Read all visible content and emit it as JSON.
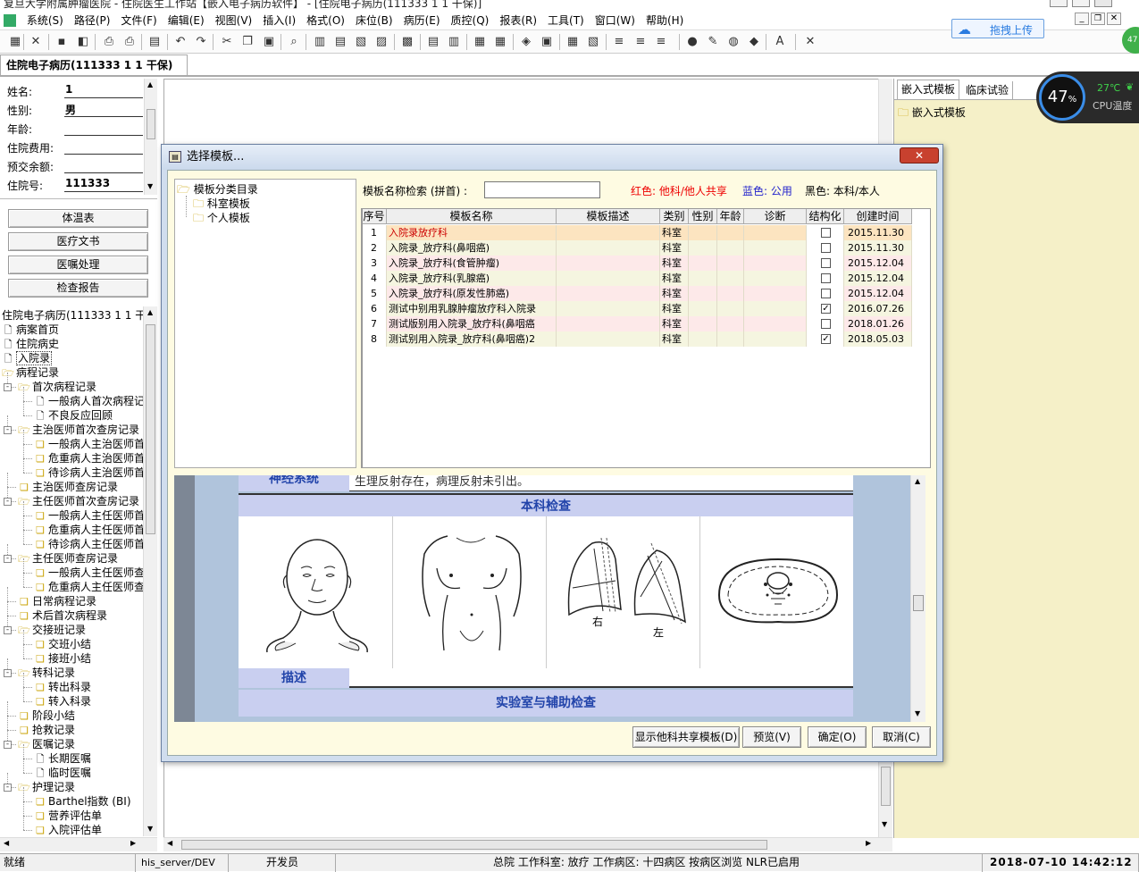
{
  "window": {
    "title": "复旦大学附属肿瘤医院 - 住院医生工作站【嵌入电子病历软件】 - [住院电子病历(111333 1 1 干保)]"
  },
  "menu": [
    "系统(S)",
    "路径(P)",
    "文件(F)",
    "编辑(E)",
    "视图(V)",
    "插入(I)",
    "格式(O)",
    "床位(B)",
    "病历(E)",
    "质控(Q)",
    "报表(R)",
    "工具(T)",
    "窗口(W)",
    "帮助(H)"
  ],
  "upload": {
    "label": "拖拽上传"
  },
  "cpu": {
    "percent": "47",
    "unit": "%",
    "temp": "27℃",
    "label": "CPU温度"
  },
  "doc_tab": "住院电子病历(111333 1 1 干保)",
  "patient": [
    {
      "label": "姓名:",
      "value": "1"
    },
    {
      "label": "性别:",
      "value": "男"
    },
    {
      "label": "年龄:",
      "value": ""
    },
    {
      "label": "住院费用:",
      "value": ""
    },
    {
      "label": "预交余额:",
      "value": ""
    },
    {
      "label": "住院号:",
      "value": "111333"
    }
  ],
  "side_buttons": [
    "体温表",
    "医疗文书",
    "医嘱处理",
    "检查报告"
  ],
  "tree": {
    "root": "住院电子病历(111333 1 1 干",
    "items": [
      {
        "label": "病案首页",
        "level": 0,
        "type": "doc"
      },
      {
        "label": "住院病史",
        "level": 0,
        "type": "doc"
      },
      {
        "label": "入院录",
        "level": 0,
        "type": "doc"
      },
      {
        "label": "病程记录",
        "level": 0,
        "type": "folder"
      },
      {
        "label": "首次病程记录",
        "level": 1,
        "type": "folder",
        "pm": "-"
      },
      {
        "label": "一般病人首次病程记",
        "level": 2,
        "type": "doc"
      },
      {
        "label": "不良反应回顾",
        "level": 2,
        "type": "doc"
      },
      {
        "label": "主治医师首次查房记录",
        "level": 1,
        "type": "folder",
        "pm": "-"
      },
      {
        "label": "一般病人主治医师首",
        "level": 2,
        "type": "multi"
      },
      {
        "label": "危重病人主治医师首",
        "level": 2,
        "type": "multi"
      },
      {
        "label": "待诊病人主治医师首",
        "level": 2,
        "type": "multi"
      },
      {
        "label": "主治医师查房记录",
        "level": 1,
        "type": "multi"
      },
      {
        "label": "主任医师首次查房记录",
        "level": 1,
        "type": "folder",
        "pm": "-"
      },
      {
        "label": "一般病人主任医师首",
        "level": 2,
        "type": "multi"
      },
      {
        "label": "危重病人主任医师首",
        "level": 2,
        "type": "multi"
      },
      {
        "label": "待诊病人主任医师首",
        "level": 2,
        "type": "multi"
      },
      {
        "label": "主任医师查房记录",
        "level": 1,
        "type": "folder",
        "pm": "-"
      },
      {
        "label": "一般病人主任医师查",
        "level": 2,
        "type": "multi"
      },
      {
        "label": "危重病人主任医师查",
        "level": 2,
        "type": "multi"
      },
      {
        "label": "日常病程记录",
        "level": 1,
        "type": "multi"
      },
      {
        "label": "术后首次病程录",
        "level": 1,
        "type": "multi"
      },
      {
        "label": "交接班记录",
        "level": 1,
        "type": "folder",
        "pm": "-"
      },
      {
        "label": "交班小结",
        "level": 2,
        "type": "multi"
      },
      {
        "label": "接班小结",
        "level": 2,
        "type": "multi"
      },
      {
        "label": "转科记录",
        "level": 1,
        "type": "folder",
        "pm": "-"
      },
      {
        "label": "转出科录",
        "level": 2,
        "type": "multi"
      },
      {
        "label": "转入科录",
        "level": 2,
        "type": "multi"
      },
      {
        "label": "阶段小结",
        "level": 1,
        "type": "multi"
      },
      {
        "label": "抢救记录",
        "level": 1,
        "type": "multi"
      },
      {
        "label": "医嘱记录",
        "level": 1,
        "type": "folder",
        "pm": "-"
      },
      {
        "label": "长期医嘱",
        "level": 2,
        "type": "doc"
      },
      {
        "label": "临时医嘱",
        "level": 2,
        "type": "doc"
      },
      {
        "label": "护理记录",
        "level": 1,
        "type": "folder",
        "pm": "-"
      },
      {
        "label": "Barthel指数 (BI)",
        "level": 2,
        "type": "multi"
      },
      {
        "label": "营养评估单",
        "level": 2,
        "type": "multi"
      },
      {
        "label": "入院评估单",
        "level": 2,
        "type": "multi"
      }
    ]
  },
  "right_tabs": [
    "嵌入式模板",
    "临床试验"
  ],
  "right_tree": [
    "嵌入式模板"
  ],
  "dialog": {
    "title": "选择模板...",
    "cat_root": "模板分类目录",
    "cats": [
      "科室模板",
      "个人模板"
    ],
    "search_label": "模板名称检索 (拼首) :",
    "search_value": "",
    "legend_red": "红色: 他科/他人共享",
    "legend_blue": "蓝色: 公用",
    "legend_black": "黑色: 本科/本人",
    "columns": [
      "序号",
      "模板名称",
      "模板描述",
      "类别",
      "性别",
      "年龄",
      "诊断",
      "结构化",
      "创建时间"
    ],
    "rows": [
      {
        "no": "1",
        "name": "入院录放疗科",
        "cat": "科室",
        "checked": false,
        "date": "2015.11.30"
      },
      {
        "no": "2",
        "name": "入院录_放疗科(鼻咽癌)",
        "cat": "科室",
        "checked": false,
        "date": "2015.11.30"
      },
      {
        "no": "3",
        "name": "入院录_放疗科(食管肿瘤)",
        "cat": "科室",
        "checked": false,
        "date": "2015.12.04"
      },
      {
        "no": "4",
        "name": "入院录_放疗科(乳腺癌)",
        "cat": "科室",
        "checked": false,
        "date": "2015.12.04"
      },
      {
        "no": "5",
        "name": "入院录_放疗科(原发性肺癌)",
        "cat": "科室",
        "checked": false,
        "date": "2015.12.04"
      },
      {
        "no": "6",
        "name": "测试中别用乳腺肿瘤放疗科入院录",
        "cat": "科室",
        "checked": true,
        "date": "2016.07.26"
      },
      {
        "no": "7",
        "name": "测试版别用入院录_放疗科(鼻咽癌",
        "cat": "科室",
        "checked": false,
        "date": "2018.01.26"
      },
      {
        "no": "8",
        "name": "测试别用入院录_放疗科(鼻咽癌)2",
        "cat": "科室",
        "checked": true,
        "date": "2018.05.03"
      }
    ],
    "preview": {
      "cut_label": "神经系统",
      "cut_text": "生理反射存在，病理反射未引出。",
      "section1": "本科检查",
      "desc_label": "描述",
      "section2": "实验室与辅助检查",
      "lung_right": "右",
      "lung_left": "左"
    },
    "buttons": [
      "显示他科共享模板(D)",
      "预览(V)",
      "确定(O)",
      "取消(C)"
    ]
  },
  "status": [
    "就绪",
    "his_server/DEV",
    "开发员",
    "总院  工作科室: 放疗  工作病区: 十四病区 按病区浏览  NLR已启用",
    "2018-07-10 14:42:12"
  ]
}
